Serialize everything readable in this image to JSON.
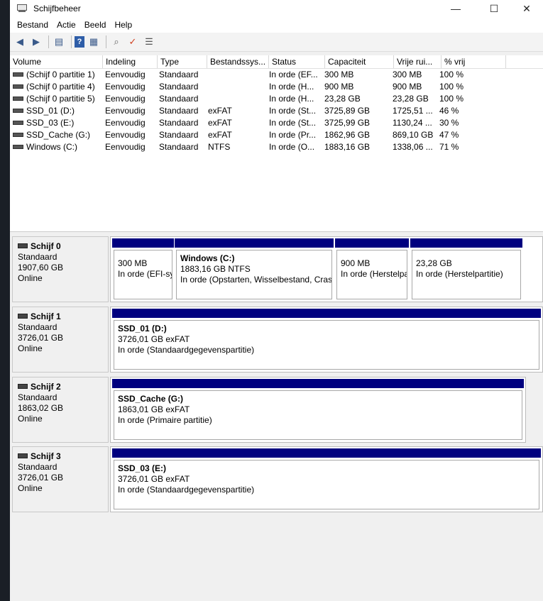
{
  "window": {
    "title": "Schijfbeheer",
    "minimize": "—",
    "maximize": "☐",
    "close": "✕"
  },
  "menu": [
    "Bestand",
    "Actie",
    "Beeld",
    "Help"
  ],
  "toolbar": {
    "icons": [
      "back-icon",
      "forward-icon",
      "properties-icon",
      "help-icon",
      "view-icon",
      "connect-icon",
      "check-icon",
      "list-icon"
    ]
  },
  "columns": [
    "Volume",
    "Indeling",
    "Type",
    "Bestandssys...",
    "Status",
    "Capaciteit",
    "Vrije rui...",
    "% vrij"
  ],
  "volumes": [
    {
      "volume": "(Schijf 0 partitie 1)",
      "layout": "Eenvoudig",
      "type": "Standaard",
      "fs": "",
      "status": "In orde (EF...",
      "capacity": "300 MB",
      "free": "300 MB",
      "pct": "100 %"
    },
    {
      "volume": "(Schijf 0 partitie 4)",
      "layout": "Eenvoudig",
      "type": "Standaard",
      "fs": "",
      "status": "In orde (H...",
      "capacity": "900 MB",
      "free": "900 MB",
      "pct": "100 %"
    },
    {
      "volume": "(Schijf 0 partitie 5)",
      "layout": "Eenvoudig",
      "type": "Standaard",
      "fs": "",
      "status": "In orde (H...",
      "capacity": "23,28 GB",
      "free": "23,28 GB",
      "pct": "100 %"
    },
    {
      "volume": "SSD_01 (D:)",
      "layout": "Eenvoudig",
      "type": "Standaard",
      "fs": "exFAT",
      "status": "In orde (St...",
      "capacity": "3725,89 GB",
      "free": "1725,51 ...",
      "pct": "46 %"
    },
    {
      "volume": "SSD_03 (E:)",
      "layout": "Eenvoudig",
      "type": "Standaard",
      "fs": "exFAT",
      "status": "In orde (St...",
      "capacity": "3725,99 GB",
      "free": "1130,24 ...",
      "pct": "30 %"
    },
    {
      "volume": "SSD_Cache (G:)",
      "layout": "Eenvoudig",
      "type": "Standaard",
      "fs": "exFAT",
      "status": "In orde (Pr...",
      "capacity": "1862,96 GB",
      "free": "869,10 GB",
      "pct": "47 %"
    },
    {
      "volume": "Windows (C:)",
      "layout": "Eenvoudig",
      "type": "Standaard",
      "fs": "NTFS",
      "status": "In orde (O...",
      "capacity": "1883,16 GB",
      "free": "1338,06 ...",
      "pct": "71 %"
    }
  ],
  "disks": [
    {
      "name": "Schijf 0",
      "type": "Standaard",
      "size": "1907,60 GB",
      "state": "Online",
      "parts": [
        {
          "name": "",
          "line1": "300 MB",
          "line2": "In orde (EFI-sy"
        },
        {
          "name": "Windows  (C:)",
          "line1": "1883,16 GB NTFS",
          "line2": "In orde (Opstarten, Wisselbestand, Crash"
        },
        {
          "name": "",
          "line1": "900 MB",
          "line2": "In orde (Herstelpa"
        },
        {
          "name": "",
          "line1": "23,28 GB",
          "line2": "In orde (Herstelpartitie)"
        }
      ]
    },
    {
      "name": "Schijf 1",
      "type": "Standaard",
      "size": "3726,01 GB",
      "state": "Online",
      "parts": [
        {
          "name": "SSD_01  (D:)",
          "line1": "3726,01 GB exFAT",
          "line2": "In orde (Standaardgegevenspartitie)"
        }
      ]
    },
    {
      "name": "Schijf 2",
      "type": "Standaard",
      "size": "1863,02 GB",
      "state": "Online",
      "parts": [
        {
          "name": "SSD_Cache  (G:)",
          "line1": "1863,01 GB exFAT",
          "line2": "In orde (Primaire partitie)"
        }
      ]
    },
    {
      "name": "Schijf 3",
      "type": "Standaard",
      "size": "3726,01 GB",
      "state": "Online",
      "parts": [
        {
          "name": "SSD_03  (E:)",
          "line1": "3726,01 GB exFAT",
          "line2": "In orde (Standaardgegevenspartitie)"
        }
      ]
    }
  ]
}
